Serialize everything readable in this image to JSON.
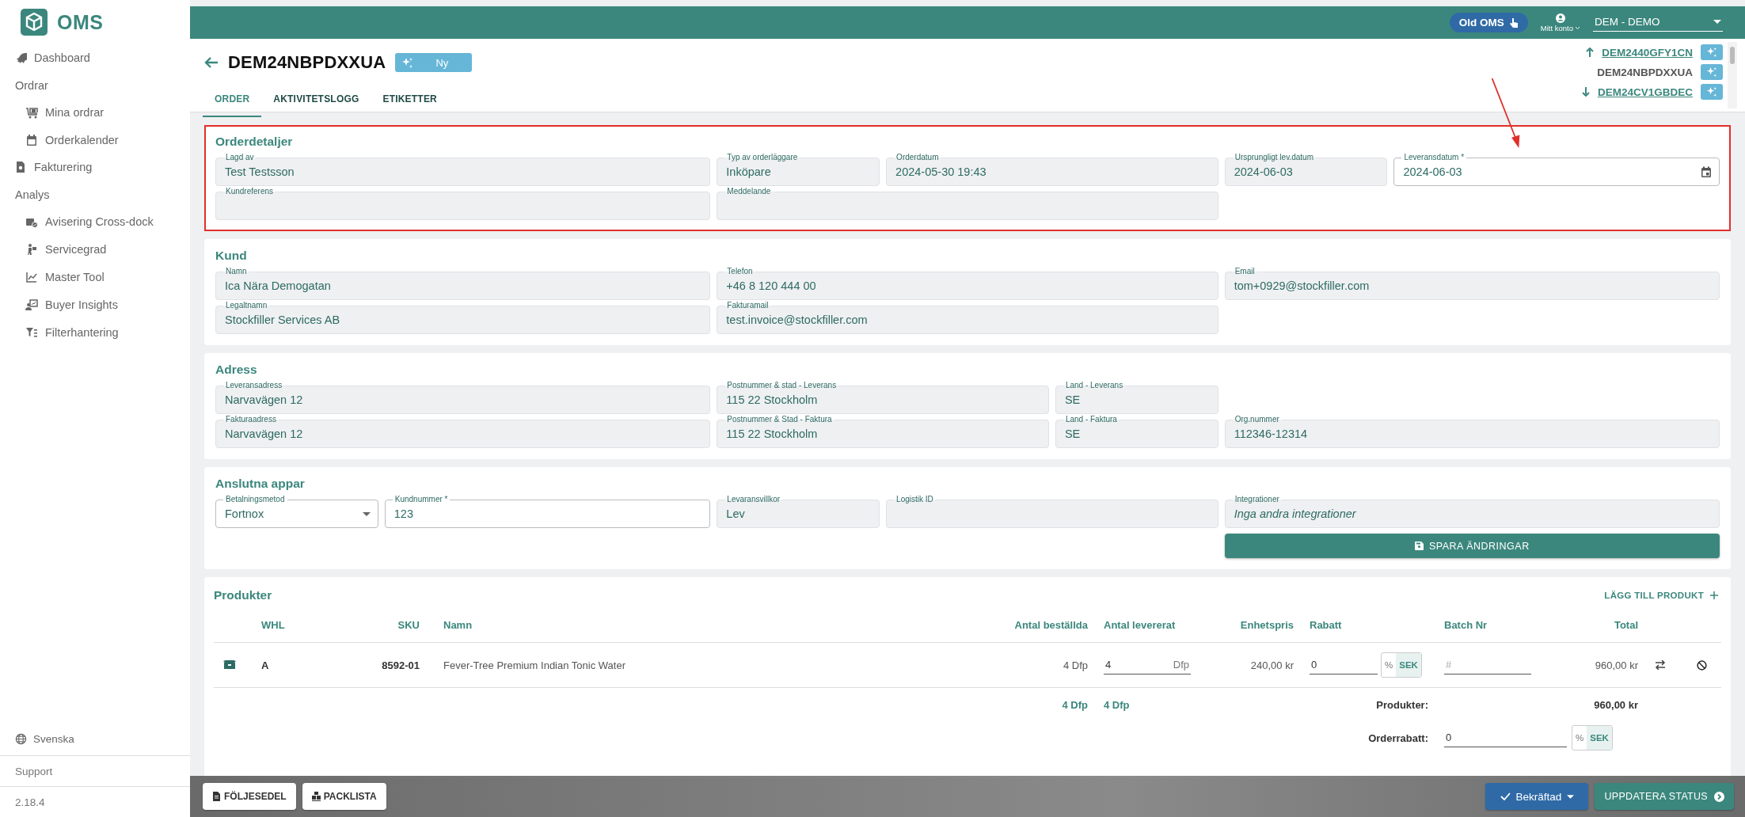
{
  "sidebar": {
    "brand": "OMS",
    "nav": [
      {
        "kind": "link",
        "label": "Dashboard"
      },
      {
        "kind": "heading",
        "label": "Ordrar"
      },
      {
        "kind": "sublink",
        "label": "Mina ordrar"
      },
      {
        "kind": "sublink",
        "label": "Orderkalender"
      },
      {
        "kind": "link",
        "label": "Fakturering"
      },
      {
        "kind": "heading",
        "label": "Analys"
      },
      {
        "kind": "sublink",
        "label": "Avisering Cross-dock"
      },
      {
        "kind": "sublink",
        "label": "Servicegrad"
      },
      {
        "kind": "sublink",
        "label": "Master Tool"
      },
      {
        "kind": "sublink",
        "label": "Buyer Insights"
      },
      {
        "kind": "sublink",
        "label": "Filterhantering"
      }
    ],
    "language": "Svenska",
    "support": "Support",
    "version": "2.18.4"
  },
  "topbar": {
    "old_oms": "Old OMS",
    "account": "Mitt konto",
    "company": "DEM - DEMO"
  },
  "order": {
    "title": "DEM24NBPDXXUA",
    "status": "Ny",
    "tabs": [
      {
        "label": "ORDER",
        "selected": true
      },
      {
        "label": "AKTIVITETSLOGG",
        "selected": false
      },
      {
        "label": "ETIKETTER",
        "selected": false
      }
    ],
    "neighbors": [
      {
        "kind": "previous",
        "id": "DEM2440GFY1CN"
      },
      {
        "kind": "current",
        "id": "DEM24NBPDXXUA"
      },
      {
        "kind": "next",
        "id": "DEM24CV1GBDEC"
      }
    ]
  },
  "annotation_arrow": true,
  "sections": [
    {
      "title": "Orderdetaljer",
      "highlighted": true,
      "rows": [
        [
          {
            "label": "Lagd av",
            "value": "Test Testsson",
            "editable": false
          },
          {
            "label": "Typ av orderläggare",
            "value": "Inköpare",
            "editable": false
          },
          {
            "label": "Orderdatum",
            "value": "2024-05-30 19:43",
            "editable": false
          },
          {
            "label": "Ursprungligt lev.datum",
            "value": "2024-06-03",
            "editable": false
          },
          {
            "kind": "date",
            "label": "Leveransdatum *",
            "value": "2024-06-03",
            "editable": true
          }
        ],
        [
          {
            "label": "Kundreferens",
            "editable": false
          },
          {
            "label": "Meddelande",
            "editable": false
          }
        ]
      ]
    },
    {
      "title": "Kund",
      "highlighted": false,
      "rows": [
        [
          {
            "label": "Namn",
            "value": "Ica Nära Demogatan",
            "editable": false
          },
          {
            "label": "Telefon",
            "value": "+46 8 120 444 00",
            "editable": false
          },
          {
            "label": "Email",
            "value": "tom+0929@stockfiller.com",
            "editable": false
          }
        ],
        [
          {
            "label": "Legaltnamn",
            "value": "Stockfiller Services AB",
            "editable": false
          },
          {
            "label": "Fakturamail",
            "value": "test.invoice@stockfiller.com",
            "editable": false
          }
        ]
      ]
    },
    {
      "title": "Adress",
      "highlighted": false,
      "rows": [
        [
          {
            "label": "Leveransadress",
            "value": "Narvavägen 12",
            "editable": false
          },
          {
            "label": "Postnummer & stad - Leverans",
            "value": "115 22 Stockholm",
            "editable": false
          },
          {
            "label": "Land - Leverans",
            "value": "SE",
            "editable": false
          }
        ],
        [
          {
            "label": "Fakturaadress",
            "value": "Narvavägen 12",
            "editable": false
          },
          {
            "label": "Postnummer & Stad - Faktura",
            "value": "115 22 Stockholm",
            "editable": false
          },
          {
            "label": "Land - Faktura",
            "value": "SE",
            "editable": false
          },
          {
            "label": "Org.nummer",
            "value": "112346-12314",
            "editable": false
          }
        ]
      ]
    },
    {
      "title": "Anslutna appar",
      "highlighted": false,
      "save_label": "SPARA ÄNDRINGAR",
      "rows": [
        [
          {
            "kind": "select",
            "label": "Betalningsmetod",
            "value": "Fortnox",
            "editable": true
          },
          {
            "label": "Kundnummer *",
            "value": "123",
            "editable": true
          },
          {
            "label": "Levaransvillkor",
            "value": "Lev",
            "editable": false
          },
          {
            "label": "Logistik ID",
            "editable": false
          },
          {
            "label": "Integrationer",
            "placeholder": "Inga andra integrationer",
            "editable": false
          }
        ]
      ]
    }
  ],
  "products": {
    "title": "Produkter",
    "add_label": "LÄGG TILL PRODUKT",
    "columns": [
      "WHL",
      "SKU",
      "Namn",
      "Antal beställda",
      "Antal levererat",
      "Enhetspris",
      "Rabatt",
      "Batch Nr",
      "Total"
    ],
    "rows": [
      {
        "whl": "A",
        "sku": "8592-01",
        "name": "Fever-Tree Premium Indian Tonic Water",
        "ordered": "4 Dfp",
        "delivered": "4",
        "delivered_unit": "Dfp",
        "unit_price": "240,00 kr",
        "discount": "0",
        "discount_units": [
          {
            "label": "%",
            "selected": false
          },
          {
            "label": "SEK",
            "selected": true
          }
        ],
        "batch_placeholder": "#",
        "total": "960,00 kr"
      }
    ],
    "sum_ordered": "4 Dfp",
    "sum_delivered": "4 Dfp",
    "products_label": "Produkter:",
    "products_total": "960,00 kr",
    "order_discount_label": "Orderrabatt:",
    "order_discount": "0",
    "order_discount_units": [
      {
        "label": "%",
        "selected": false
      },
      {
        "label": "SEK",
        "selected": true
      }
    ]
  },
  "footer": {
    "buttons": [
      "FÖLJESEDEL",
      "PACKLISTA"
    ],
    "status": "Bekräftad",
    "update_label": "UPPDATERA STATUS"
  }
}
